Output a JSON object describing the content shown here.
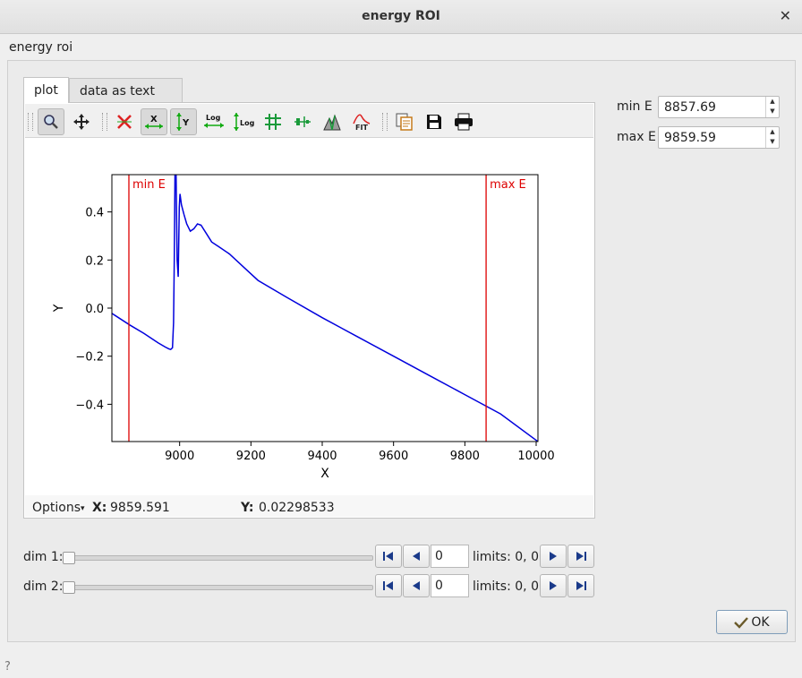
{
  "window": {
    "title": "energy ROI"
  },
  "group": {
    "label": "energy roi"
  },
  "tabs": [
    {
      "label": "plot"
    },
    {
      "label": "data as text"
    }
  ],
  "status": {
    "options_label": "Options",
    "x_label": "X:",
    "x_value": "9859.591",
    "y_label": "Y:",
    "y_value": "0.02298533"
  },
  "roi": {
    "min_label": "min E",
    "min_value": "8857.69",
    "max_label": "max E",
    "max_value": "9859.59"
  },
  "dims": [
    {
      "label": "dim 1:",
      "value": "0",
      "limits": "limits: 0, 0",
      "slider_fraction": 0
    },
    {
      "label": "dim 2:",
      "value": "0",
      "limits": "limits: 0, 0",
      "slider_fraction": 0
    }
  ],
  "ok_label": "OK",
  "help_glyph": "?",
  "colors": {
    "curve": "#0000dd",
    "roi_line": "#dd0000"
  },
  "toolbar_icons": [
    "zoom-icon",
    "pan-icon",
    "reset-zoom-icon",
    "x-autoscale-icon",
    "y-autoscale-icon",
    "x-log-icon",
    "y-log-icon",
    "grid-icon",
    "curve-style-icon",
    "colormap-icon",
    "fit-icon",
    "copy-icon",
    "save-icon",
    "print-icon"
  ],
  "chart_data": {
    "type": "line",
    "xlabel": "X",
    "ylabel": "Y",
    "xlim": [
      8810,
      10005
    ],
    "ylim": [
      -0.555,
      0.555
    ],
    "xticks": [
      9000,
      9200,
      9400,
      9600,
      9800,
      10000
    ],
    "yticks": [
      -0.4,
      -0.2,
      0.0,
      0.2,
      0.4
    ],
    "ytick_labels": [
      "−0.4",
      "−0.2",
      "0.0",
      "0.2",
      "0.4"
    ],
    "markers": [
      {
        "label": "min E",
        "x": 8857.69
      },
      {
        "label": "max E",
        "x": 9859.59
      }
    ],
    "series": [
      {
        "x": [
          8810,
          8860,
          8900,
          8940,
          8960,
          8970,
          8975,
          8980,
          8983,
          8985,
          8987,
          8990,
          8993,
          8996,
          8999,
          9001,
          9005,
          9012,
          9020,
          9030,
          9040,
          9050,
          9060,
          9075,
          9090,
          9110,
          9140,
          9180,
          9220,
          9300,
          9400,
          9500,
          9600,
          9700,
          9800,
          9900,
          10005
        ],
        "y": [
          -0.022,
          -0.07,
          -0.105,
          -0.145,
          -0.162,
          -0.17,
          -0.172,
          -0.165,
          -0.06,
          0.2,
          0.56,
          0.56,
          0.2,
          0.13,
          0.42,
          0.475,
          0.43,
          0.39,
          0.35,
          0.32,
          0.33,
          0.35,
          0.345,
          0.31,
          0.275,
          0.255,
          0.225,
          0.17,
          0.115,
          0.045,
          -0.04,
          -0.12,
          -0.2,
          -0.28,
          -0.36,
          -0.44,
          -0.555
        ]
      }
    ]
  }
}
